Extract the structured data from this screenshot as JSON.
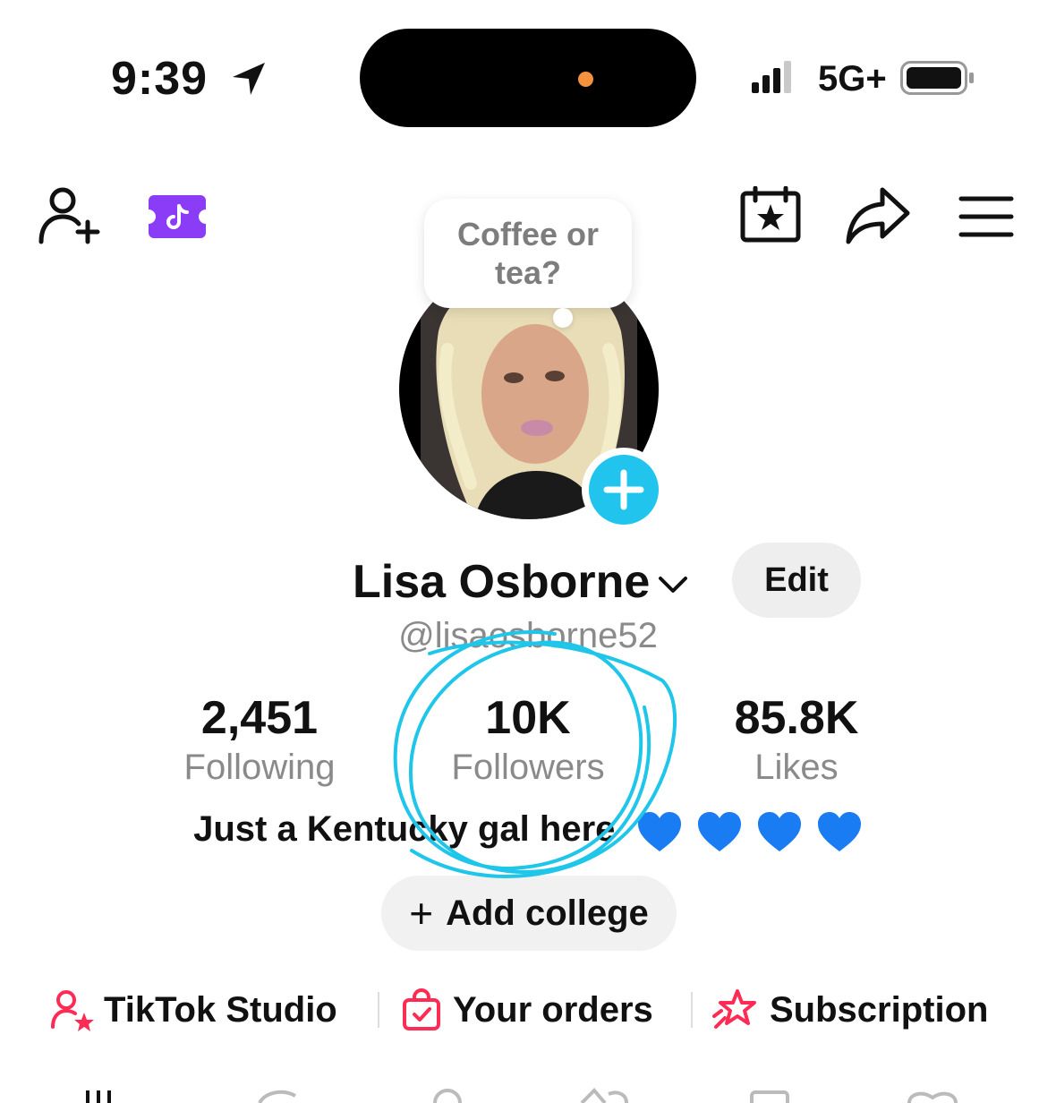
{
  "status_bar": {
    "time": "9:39",
    "network": "5G+"
  },
  "icons": {
    "add_friend": "add-friend-icon",
    "ticket": "tiktok-ticket-icon",
    "calendar": "calendar-star-icon",
    "share": "share-icon",
    "menu": "menu-icon",
    "add_avatar": "plus-icon"
  },
  "note": {
    "text": "Coffee or tea?"
  },
  "profile": {
    "display_name": "Lisa Osborne",
    "handle": "@lisaosborne52",
    "edit_label": "Edit",
    "bio": "Just a Kentucky gal here",
    "bio_emoji": [
      "blue-heart",
      "blue-heart",
      "blue-heart",
      "blue-heart"
    ]
  },
  "stats": {
    "following": {
      "value": "2,451",
      "label": "Following"
    },
    "followers": {
      "value": "10K",
      "label": "Followers"
    },
    "likes": {
      "value": "85.8K",
      "label": "Likes"
    }
  },
  "add_college": {
    "plus": "+",
    "label": "Add college"
  },
  "tools": [
    {
      "label": "TikTok Studio",
      "icon": "studio-icon"
    },
    {
      "label": "Your orders",
      "icon": "shopping-bag-icon"
    },
    {
      "label": "Subscription",
      "icon": "star-subscription-icon"
    }
  ],
  "colors": {
    "accent_pink": "#fe2c55",
    "avatar_add_blue": "#20c4ec",
    "ticket_purple": "#8b3cf7",
    "heart_blue": "#1a7cf2",
    "annotation_cyan": "#1fc6ea"
  }
}
